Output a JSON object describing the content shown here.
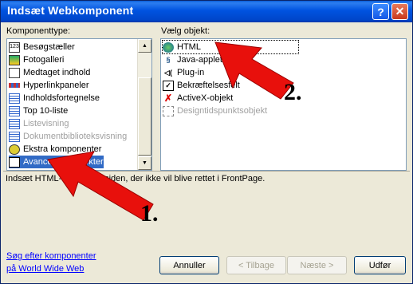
{
  "window": {
    "title": "Indsæt Webkomponent"
  },
  "left": {
    "label": "Komponenttype:",
    "items": [
      {
        "label": "Besøgstæller",
        "icon": "counter-icon",
        "state": "normal"
      },
      {
        "label": "Fotogalleri",
        "icon": "photo-gallery-icon",
        "state": "normal"
      },
      {
        "label": "Medtaget indhold",
        "icon": "included-content-icon",
        "state": "normal"
      },
      {
        "label": "Hyperlinkpaneler",
        "icon": "link-bar-icon",
        "state": "normal"
      },
      {
        "label": "Indholdsfortegnelse",
        "icon": "table-of-contents-icon",
        "state": "normal"
      },
      {
        "label": "Top 10-liste",
        "icon": "top10-list-icon",
        "state": "normal"
      },
      {
        "label": "Listevisning",
        "icon": "list-view-icon",
        "state": "disabled"
      },
      {
        "label": "Dokumentbiblioteksvisning",
        "icon": "document-library-icon",
        "state": "disabled"
      },
      {
        "label": "Ekstra komponenter",
        "icon": "extra-components-icon",
        "state": "normal"
      },
      {
        "label": "Avancerede objekter",
        "icon": "advanced-objects-icon",
        "state": "selected"
      }
    ]
  },
  "right": {
    "label": "Vælg objekt:",
    "items": [
      {
        "label": "HTML",
        "icon": "html-globe-icon",
        "state": "focused"
      },
      {
        "label": "Java-applet",
        "icon": "java-applet-icon",
        "state": "normal"
      },
      {
        "label": "Plug-in",
        "icon": "plugin-icon",
        "state": "normal"
      },
      {
        "label": "Bekræftelsesfelt",
        "icon": "confirmation-field-icon",
        "state": "normal"
      },
      {
        "label": "ActiveX-objekt",
        "icon": "activex-icon",
        "state": "normal"
      },
      {
        "label": "Designtidspunktsobjekt",
        "icon": "design-time-control-icon",
        "state": "disabled"
      }
    ]
  },
  "description": "Indsæt HTML-indhold på siden, der ikke vil blive rettet i FrontPage.",
  "links": {
    "search": "Søg efter komponenter",
    "web": "på World Wide Web"
  },
  "buttons": {
    "cancel": "Annuller",
    "back": "< Tilbage",
    "next": "Næste >",
    "finish": "Udfør"
  },
  "annotations": {
    "one": "1.",
    "two": "2."
  },
  "colors": {
    "titlebar": "#0053e0",
    "selection": "#316ac5",
    "arrow": "#e8100c"
  }
}
